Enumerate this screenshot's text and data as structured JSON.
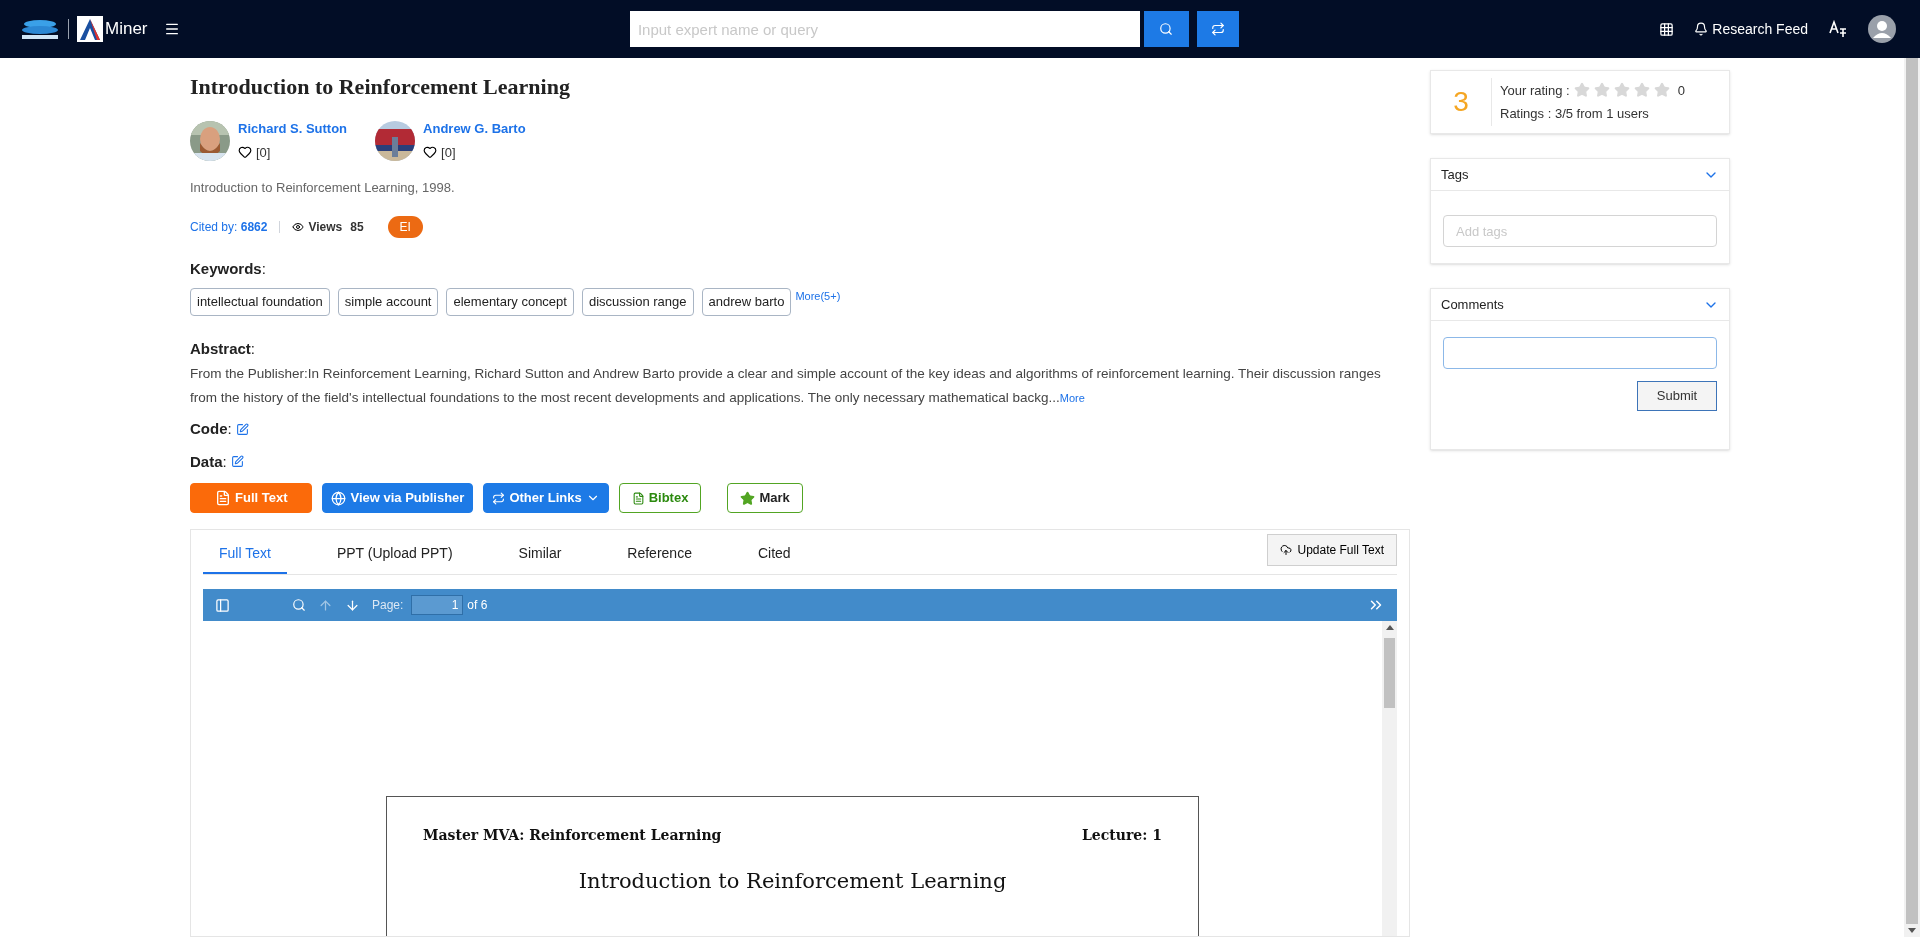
{
  "header": {
    "logo_text": "Miner",
    "search": {
      "placeholder": "Input expert name or query"
    },
    "research_feed": "Research Feed"
  },
  "paper": {
    "title": "Introduction to Reinforcement Learning",
    "authors": [
      {
        "name": "Richard S. Sutton",
        "likes": "[0]"
      },
      {
        "name": "Andrew G. Barto",
        "likes": "[0]"
      }
    ],
    "venue": "Introduction to Reinforcement Learning, 1998.",
    "cited_label": "Cited by:",
    "cited_count": "6862",
    "views_label": "Views",
    "views_count": "85",
    "badge": "EI"
  },
  "keywords": {
    "label": "**Keywords**:",
    "items": [
      "intellectual foundation",
      "simple account",
      "elementary concept",
      "discussion range",
      "andrew barto"
    ],
    "more": "More(5+)"
  },
  "abstract": {
    "label": "**Abstract**:",
    "text": "From the Publisher:In Reinforcement Learning, Richard Sutton and Andrew Barto provide a clear and simple account of the key ideas and algorithms of reinforcement learning. Their discussion ranges from the history of the field's intellectual foundations to the most recent developments and applications. The only necessary mathematical backg...",
    "more": "More"
  },
  "code_label": "**Code**:",
  "data_label": "**Data**:",
  "actions": [
    {
      "label": "Full Text",
      "kind": "pdf"
    },
    {
      "label": "View via Publisher",
      "kind": "globe"
    },
    {
      "label": "Other Links",
      "kind": "links"
    },
    {
      "label": "Bibtex",
      "kind": "bibtex"
    },
    {
      "label": "Mark",
      "kind": "mark"
    }
  ],
  "tabs": [
    {
      "label": "Full Text",
      "selected": true
    },
    {
      "label": "PPT (Upload PPT)",
      "selected": false
    },
    {
      "label": "Similar",
      "selected": false
    },
    {
      "label": "Reference",
      "selected": false
    },
    {
      "label": "Cited",
      "selected": false
    }
  ],
  "update_button": "Update Full Text",
  "pdf_viewer": {
    "page_label": "Page:",
    "page": "1",
    "page_count": "of 6",
    "document": {
      "header_left": "Master MVA: Reinforcement Learning",
      "header_right": "Lecture: 1",
      "title": "Introduction to Reinforcement Learning"
    }
  },
  "rating": {
    "score": "3",
    "your_rating_label": "Your rating :",
    "stars": 0,
    "your_rating_value": "0",
    "summary": "Ratings : 3/5 from 1 users"
  },
  "tags": {
    "title": "Tags",
    "placeholder": "Add tags"
  },
  "comments": {
    "title": "Comments",
    "submit": "Submit"
  }
}
